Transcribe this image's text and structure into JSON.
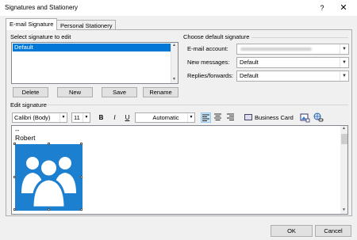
{
  "window": {
    "title": "Signatures and Stationery",
    "help_glyph": "?",
    "close_glyph": "✕"
  },
  "tabs": [
    {
      "label": "E-mail Signature",
      "active": true
    },
    {
      "label": "Personal Stationery",
      "active": false
    }
  ],
  "select_signature": {
    "label": "Select signature to edit",
    "items": [
      "Default"
    ],
    "selected": "Default"
  },
  "signature_buttons": {
    "delete": "Delete",
    "new": "New",
    "save": "Save",
    "rename": "Rename"
  },
  "choose_default": {
    "label": "Choose default signature",
    "email_account_label": "E-mail account:",
    "email_account_value": "",
    "new_messages_label": "New messages:",
    "new_messages_value": "Default",
    "replies_label": "Replies/forwards:",
    "replies_value": "Default"
  },
  "edit_signature": {
    "label": "Edit signature",
    "font": "Calibri (Body)",
    "size": "11",
    "bold": "B",
    "italic": "I",
    "underline": "U",
    "color": "Automatic",
    "business_card": "Business Card",
    "icons": [
      "align-left-icon",
      "align-center-icon",
      "align-right-icon",
      "business-card-icon",
      "insert-picture-icon",
      "hyperlink-icon"
    ]
  },
  "editor": {
    "line1": "--",
    "line2": "Robert",
    "image_icon": "people-group-icon",
    "image_color": "#1d7fd0"
  },
  "footer": {
    "ok": "OK",
    "cancel": "Cancel"
  },
  "colors": {
    "selection": "#0078d7",
    "image_bg": "#1d7fd0"
  }
}
